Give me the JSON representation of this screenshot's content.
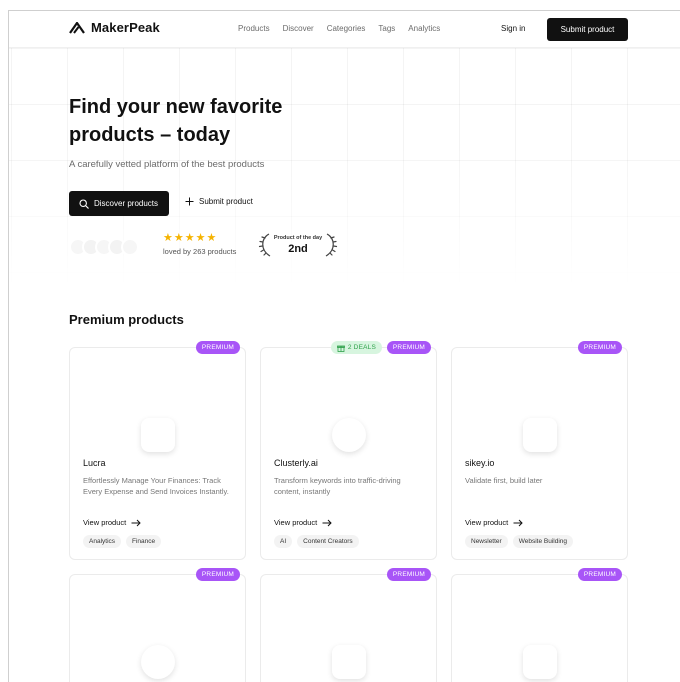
{
  "nav": {
    "brand": "MakerPeak",
    "links": [
      "Products",
      "Discover",
      "Categories",
      "Tags",
      "Analytics"
    ],
    "signin": "Sign in",
    "submit": "Submit product"
  },
  "hero": {
    "title": "Find your new favorite products – today",
    "subtitle": "A carefully vetted platform of the best products",
    "cta_primary": "Discover products",
    "cta_secondary": "Submit product",
    "rating_stars": 5,
    "loved_by": "loved by 263 products",
    "potd_label": "Product of the day",
    "potd_rank": "2nd"
  },
  "premium": {
    "title": "Premium products",
    "badge": "PREMIUM",
    "cards": [
      {
        "name": "Lucra",
        "description": "Effortlessly Manage Your Finances: Track Every Expense and Send Invoices Instantly.",
        "link": "View product",
        "tags": [
          "Analytics",
          "Finance"
        ],
        "deals": ""
      },
      {
        "name": "Clusterly.ai",
        "description": "Transform keywords into traffic-driving content, instantly",
        "link": "View product",
        "tags": [
          "AI",
          "Content Creators"
        ],
        "deals": "2 DEALS"
      },
      {
        "name": "sikey.io",
        "description": "Validate first, build later",
        "link": "View product",
        "tags": [
          "Newsletter",
          "Website Building"
        ],
        "deals": ""
      }
    ]
  },
  "colors": {
    "primary": "#111111",
    "premium_badge": "#a855f7",
    "deals_badge_bg": "#d7f5df",
    "deals_badge_text": "#2fa14a",
    "star": "#f5b301"
  },
  "icons": {
    "logo": "mountain-logo-icon",
    "search": "search-icon",
    "plus": "plus-icon",
    "arrow": "arrow-right-icon",
    "gift": "gift-icon",
    "laurel": "laurel-icon"
  }
}
